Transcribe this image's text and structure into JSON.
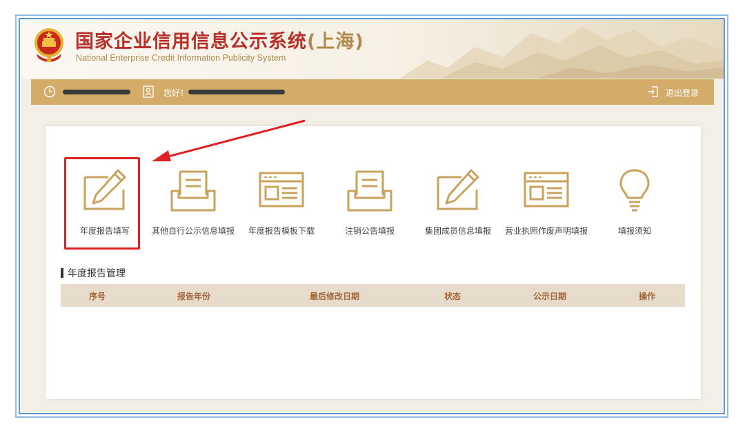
{
  "header": {
    "title_main": "国家企业信用信息公示系统",
    "title_region": "(上海)",
    "subtitle": "National Enterprise Credit Information Publicity System"
  },
  "topbar": {
    "greeting": "您好！",
    "logout_label": "退出登录"
  },
  "tiles": [
    {
      "label": "年度报告填写",
      "icon": "edit-icon"
    },
    {
      "label": "其他自行公示信息填报",
      "icon": "inbox-tray-icon"
    },
    {
      "label": "年度报告模板下载",
      "icon": "template-window-icon"
    },
    {
      "label": "注销公告填报",
      "icon": "inbox-tray-icon"
    },
    {
      "label": "集团成员信息填报",
      "icon": "edit-icon"
    },
    {
      "label": "营业执照作废声明填报",
      "icon": "template-window-icon"
    },
    {
      "label": "填报须知",
      "icon": "lightbulb-icon"
    }
  ],
  "section": {
    "title": "年度报告管理"
  },
  "table": {
    "columns": [
      "序号",
      "报告年份",
      "最后修改日期",
      "状态",
      "公示日期",
      "操作"
    ],
    "rows": []
  },
  "colors": {
    "accent_gold": "#d2ac68",
    "title_red": "#b82f2a",
    "highlight_red": "#e02020",
    "frame_blue": "#5b9bd5"
  }
}
